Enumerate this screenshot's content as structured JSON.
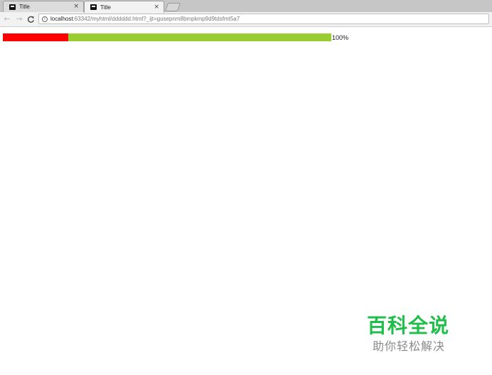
{
  "browser": {
    "tabs": [
      {
        "title": "Title",
        "close": "×"
      },
      {
        "title": "Title",
        "close": "×"
      }
    ],
    "nav": {
      "back": "←",
      "forward": "→",
      "reload": "C"
    },
    "address": {
      "host": "localhost",
      "rest": ":63342/myhtml/dddddd.html?_ijt=gusepnm8bmpkmp9d9tdsfmt5a7"
    }
  },
  "page": {
    "progress": {
      "label": "100%",
      "red_fraction": 0.2,
      "track_color": "#9acd32",
      "fill_color": "#ff0000"
    }
  },
  "watermark": {
    "title": "百科全说",
    "subtitle": "助你轻松解决",
    "color": "#1fbd4a"
  }
}
